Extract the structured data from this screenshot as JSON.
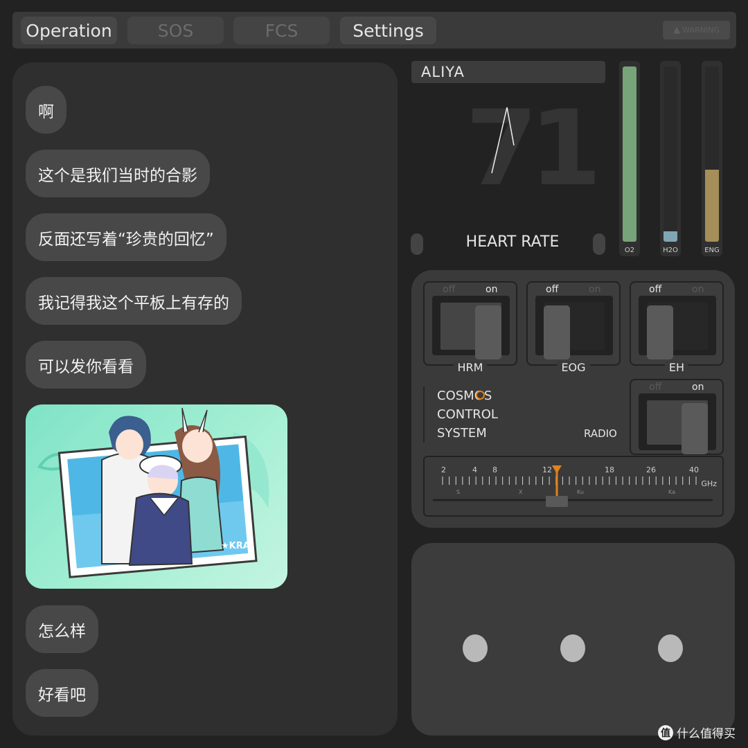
{
  "tabs": [
    {
      "label": "Operation",
      "active": true
    },
    {
      "label": "SOS",
      "active": false
    },
    {
      "label": "FCS",
      "active": false
    },
    {
      "label": "Settings",
      "active": true
    }
  ],
  "warning": {
    "label": "WARNING",
    "icon": "warning-triangle-icon"
  },
  "chat": {
    "messages": [
      "啊",
      "这个是我们当时的合影",
      "反面还写着“珍贵的回忆”",
      "我记得我这个平板上有存的",
      "可以发你看看",
      "怎么样",
      "好看吧"
    ],
    "photo": {
      "signature": "★KRA"
    }
  },
  "monitor": {
    "name": "ALIYA",
    "heart_rate": "71",
    "heart_rate_label": "HEART RATE"
  },
  "gauges": [
    {
      "label": "O2",
      "level": 1.0,
      "color": "#78a47a"
    },
    {
      "label": "H2O",
      "level": 0.06,
      "color": "#7fa6b4"
    },
    {
      "label": "ENG",
      "level": 0.41,
      "color": "#a58e5a"
    }
  ],
  "switches": [
    {
      "name": "HRM",
      "off_label": "off",
      "on_label": "on",
      "state": "on"
    },
    {
      "name": "EOG",
      "off_label": "off",
      "on_label": "on",
      "state": "off"
    },
    {
      "name": "EH",
      "off_label": "off",
      "on_label": "on",
      "state": "off"
    }
  ],
  "cosmos": {
    "line1": "COSMOS",
    "line2": "CONTROL",
    "line3": "SYSTEM"
  },
  "radio": {
    "label": "RADIO",
    "off_label": "off",
    "on_label": "on",
    "state": "on"
  },
  "dial": {
    "unit": "GHz",
    "ticks": [
      "2",
      "4",
      "8",
      "12",
      "18",
      "26",
      "40"
    ],
    "bands": [
      "S",
      "X",
      "Ku",
      "Ka"
    ],
    "value_ghz": 13,
    "accent": "#e0821d"
  },
  "watermark": {
    "icon": "值",
    "text": "什么值得买"
  }
}
